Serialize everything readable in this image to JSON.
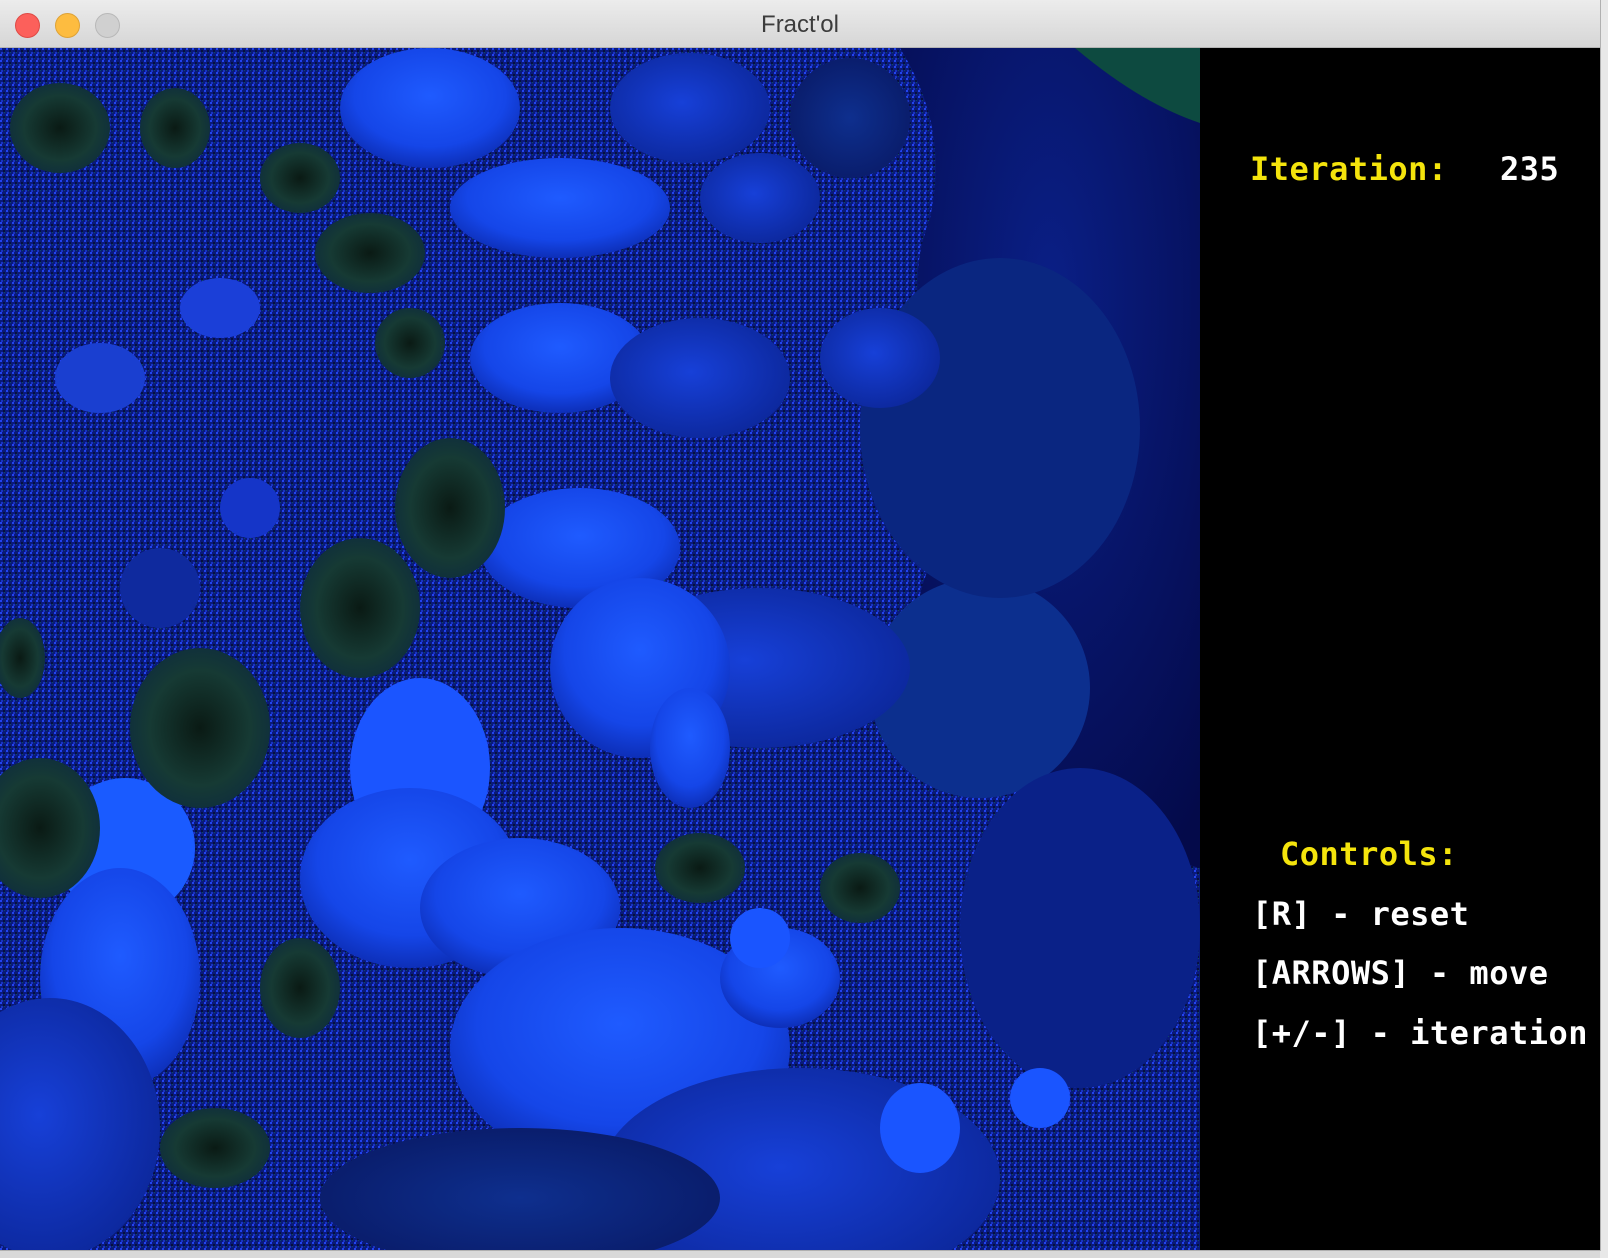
{
  "window": {
    "title": "Fract'ol"
  },
  "info_panel": {
    "iteration_label": "Iteration:",
    "iteration_value": "235",
    "controls_title": "Controls:",
    "controls": [
      "[R] - reset",
      "[ARROWS] - move",
      "[+/-] - iteration"
    ],
    "label_color": "#f4e40c",
    "value_color": "#ffffff"
  },
  "fractal": {
    "palette": [
      "#0a1c9a",
      "#0d36d8",
      "#1a55f5",
      "#0e2a8a",
      "#06104f",
      "#1d3d36",
      "#0b1a40"
    ]
  }
}
